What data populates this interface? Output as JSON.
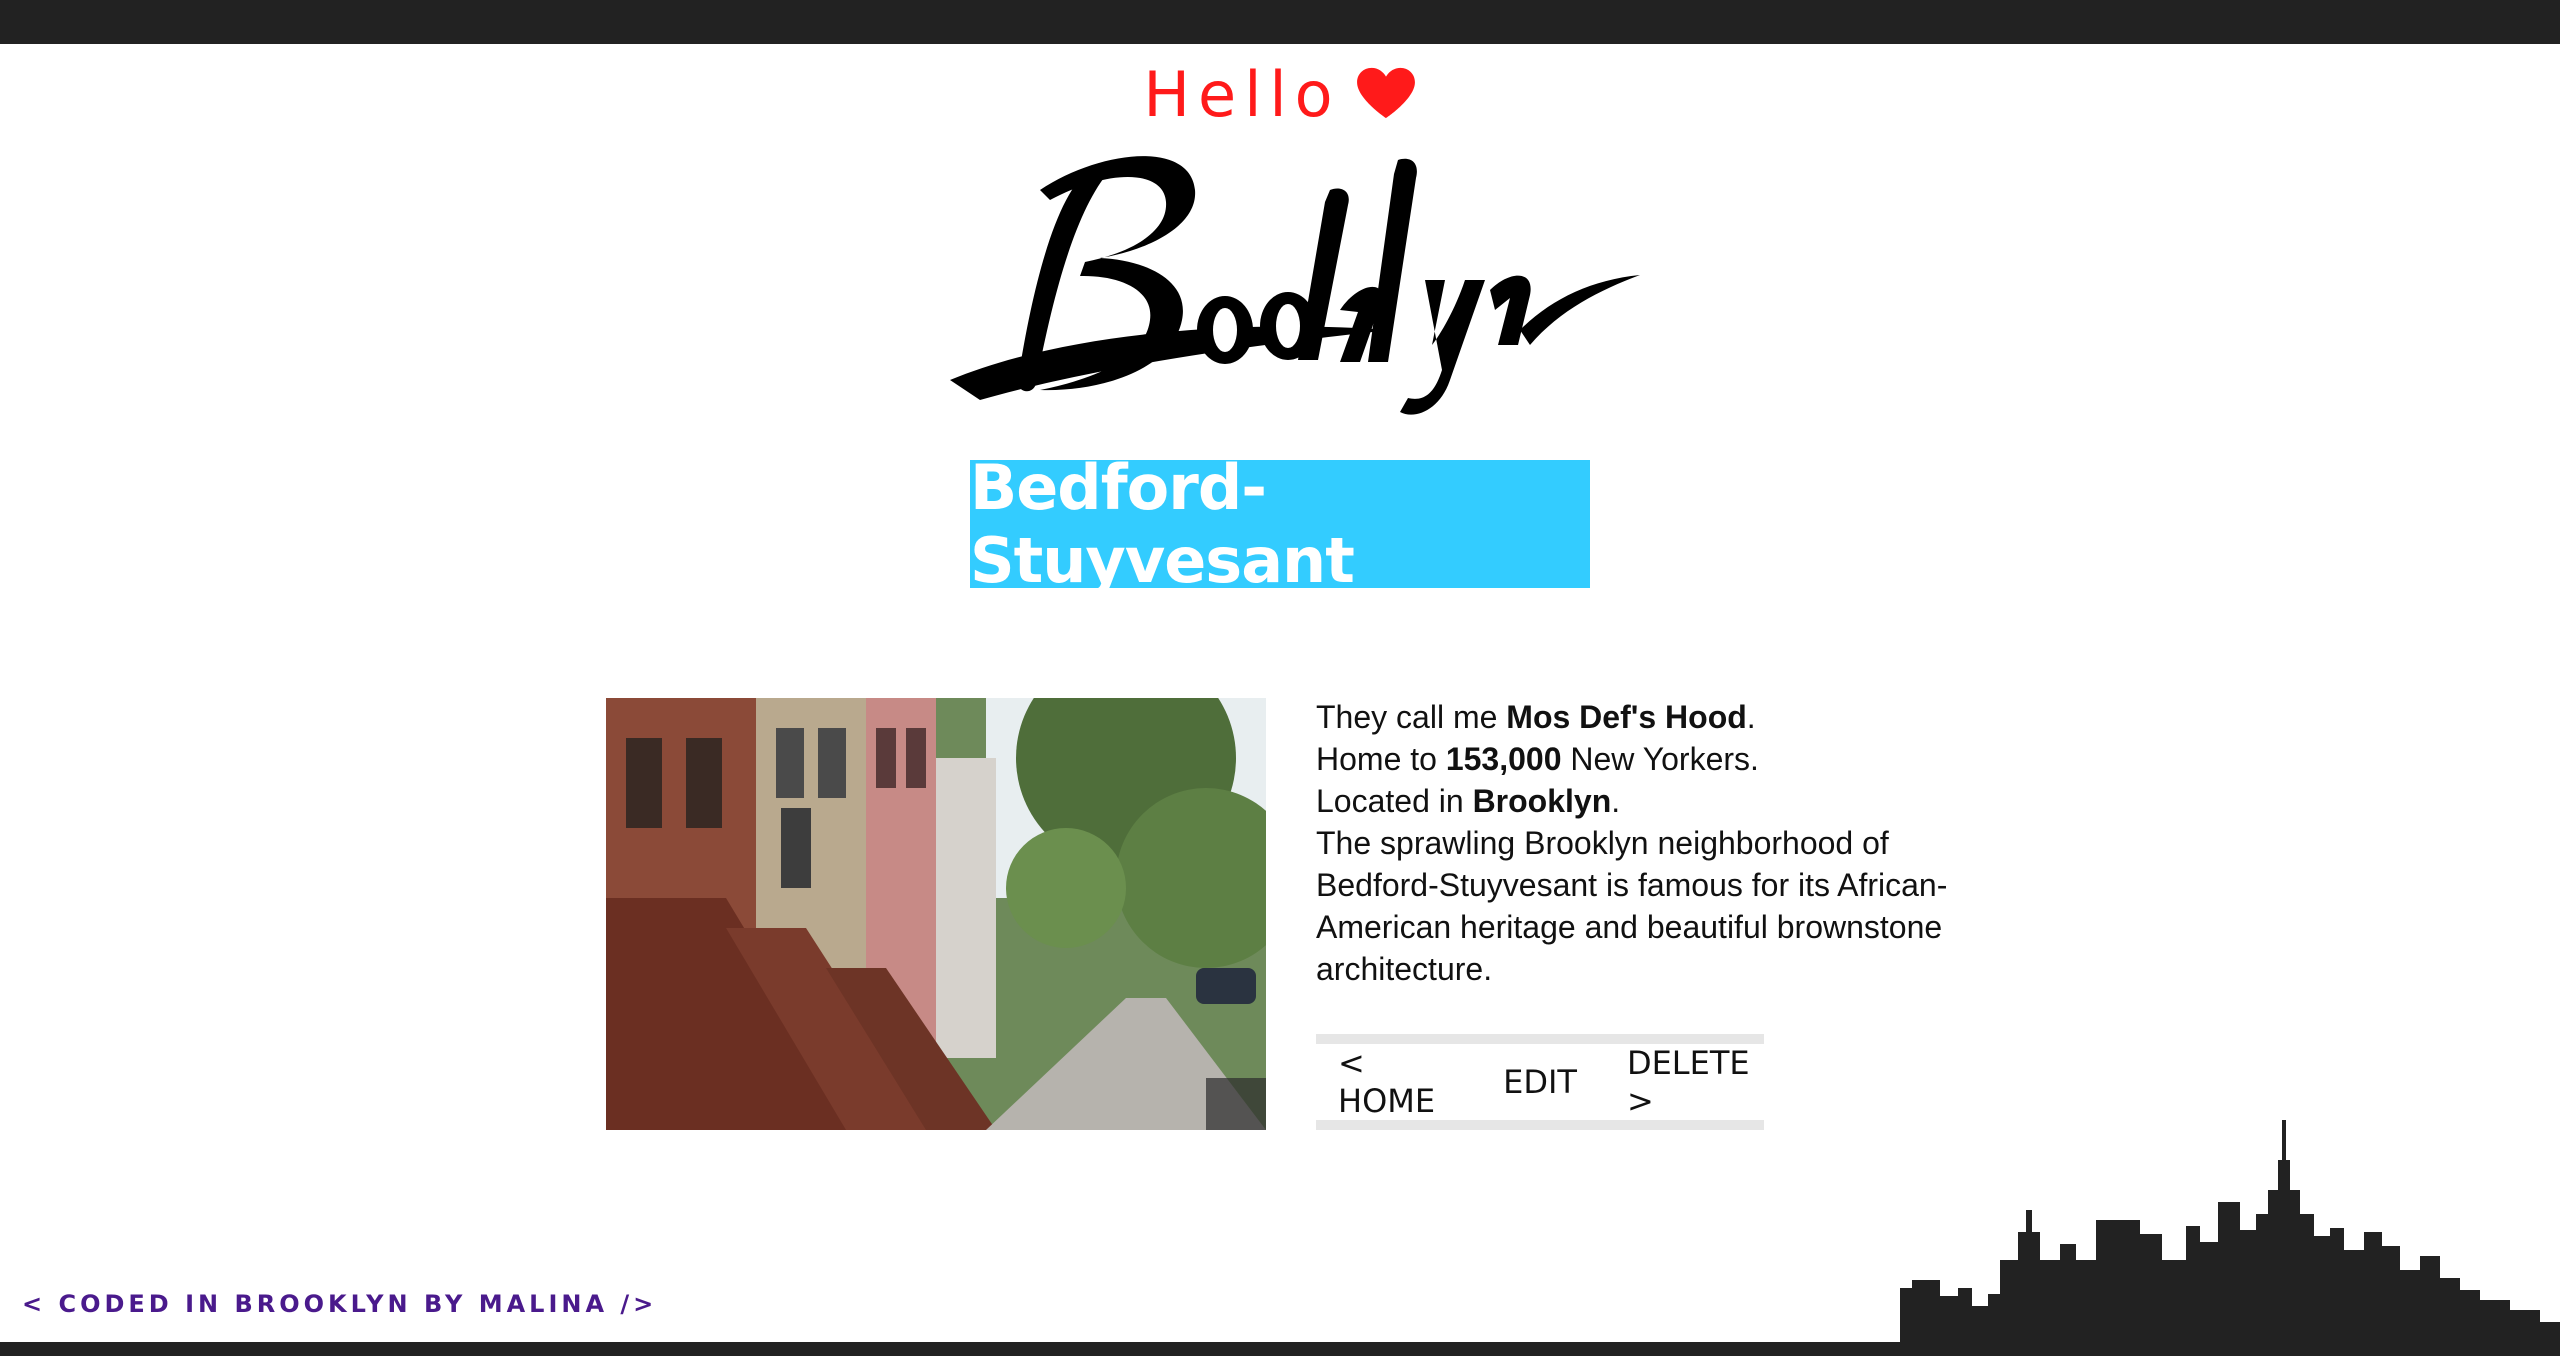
{
  "header": {
    "greeting": "Hello",
    "logo_text": "Brooklyn"
  },
  "neighborhood": {
    "name": "Bedford-Stuyvesant",
    "nickname_prefix": "They call me ",
    "nickname": "Mos Def's Hood",
    "population_prefix": "Home to ",
    "population": "153,000",
    "population_suffix": " New Yorkers.",
    "location_prefix": "Located in ",
    "borough": "Brooklyn",
    "description": "The sprawling Brooklyn neighborhood of Bedford-Stuyvesant is famous for its African-American heritage and beautiful brownstone architecture."
  },
  "nav": {
    "home_label": "< HOME",
    "edit_label": "EDIT",
    "delete_label": "DELETE >"
  },
  "footer": {
    "credit": "< CODED IN BROOKLYN BY MALINA />"
  },
  "colors": {
    "accent": "#33ccff",
    "heart": "#ff1a1a",
    "footer_text": "#4a1a8c",
    "bars": "#222222"
  },
  "icons": {
    "heart": "heart-icon",
    "skyline": "skyline-silhouette"
  }
}
